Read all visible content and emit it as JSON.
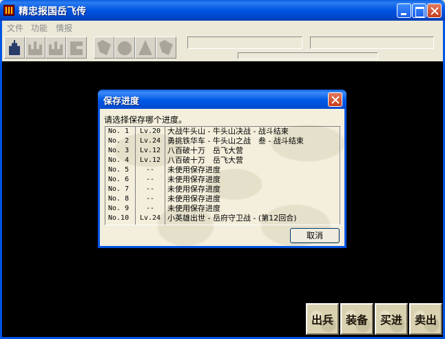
{
  "window": {
    "title": "精忠报国岳飞传"
  },
  "menu": [
    "文件",
    "功能",
    "情报"
  ],
  "actions": [
    "出兵",
    "装备",
    "买进",
    "卖出"
  ],
  "dialog": {
    "title": "保存进度",
    "prompt": "请选择保存哪个进度。",
    "cancel_label": "取消",
    "rows": [
      {
        "no": "No. 1",
        "lv": "Lv.20",
        "desc": "大战牛头山 - 牛头山决战 - 战斗结束"
      },
      {
        "no": "No. 2",
        "lv": "Lv.24",
        "desc": "勇挑铁华车 - 牛头山之战　叁 - 战斗结束"
      },
      {
        "no": "No. 3",
        "lv": "Lv.12",
        "desc": "八百破十万　岳飞大营"
      },
      {
        "no": "No. 4",
        "lv": "Lv.12",
        "desc": "八百破十万　岳飞大营"
      },
      {
        "no": "No. 5",
        "lv": "--",
        "desc": "未使用保存进度"
      },
      {
        "no": "No. 6",
        "lv": "--",
        "desc": "未使用保存进度"
      },
      {
        "no": "No. 7",
        "lv": "--",
        "desc": "未使用保存进度"
      },
      {
        "no": "No. 8",
        "lv": "--",
        "desc": "未使用保存进度"
      },
      {
        "no": "No. 9",
        "lv": "--",
        "desc": "未使用保存进度"
      },
      {
        "no": "No.10",
        "lv": "Lv.24",
        "desc": "小英雄出世 - 岳府守卫战 - (第12回合)"
      }
    ]
  },
  "icons": {
    "toolbar": [
      "castle-icon",
      "fortress-icon",
      "fortress-icon",
      "scroll-icon",
      "horse-icon",
      "dragon-icon",
      "mountain-icon",
      "crest-icon"
    ]
  }
}
